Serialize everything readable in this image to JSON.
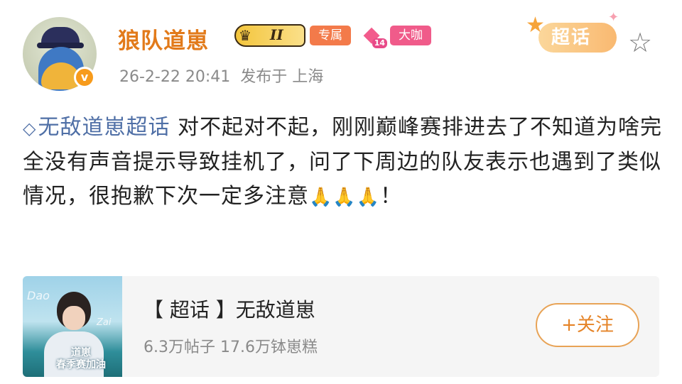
{
  "author": {
    "name": "狼队道崽",
    "level_badge": "II",
    "tag_exclusive": "专属",
    "gem_number": "14",
    "tag_vip": "大咖",
    "verified_icon": "verified-v-icon",
    "timestamp": "26-2-22 20:41",
    "location": "发布于 上海"
  },
  "header_right": {
    "supertopic_label": "超话",
    "favorite_icon": "star-outline-icon"
  },
  "post": {
    "topic_name": "无敌道崽超话",
    "text": " 对不起对不起，刚刚巅峰赛排进去了不知道为啥完全没有声音提示导致挂机了，问了下周边的队友表示也遇到了类似情况，很抱歉下次一定多注意",
    "emoji": "🙏🙏🙏",
    "ending": "！"
  },
  "card": {
    "title": "【 超话 】无敌道崽",
    "stats": "6.3万帖子  17.6万钵崽糕",
    "thumbnail_caption": "道崽\n春季赛加油",
    "thumbnail_script1": "Dao",
    "thumbnail_script2": "Zai",
    "follow_label": "+关注"
  },
  "colors": {
    "username": "#e27a1a",
    "topic_link": "#4f6fa6",
    "follow_border": "#e8a356",
    "follow_text": "#e58428",
    "meta_gray": "#8a8a8a"
  }
}
